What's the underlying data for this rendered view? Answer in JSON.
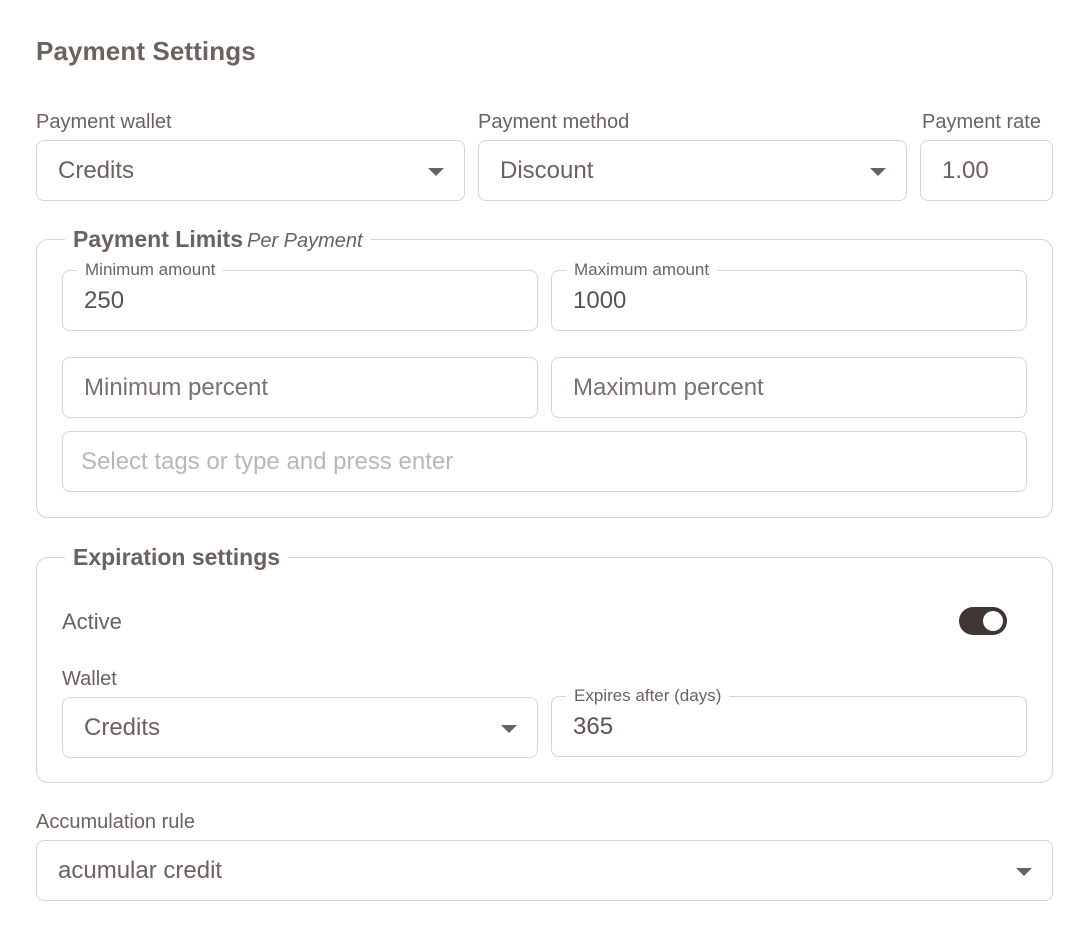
{
  "page": {
    "title": "Payment Settings"
  },
  "payment": {
    "wallet_label": "Payment wallet",
    "wallet_value": "Credits",
    "method_label": "Payment method",
    "method_value": "Discount",
    "rate_label": "Payment rate",
    "rate_value": "1.00"
  },
  "limits": {
    "legend": "Payment Limits",
    "legend_sub": "Per Payment",
    "min_amount_label": "Minimum amount",
    "min_amount_value": "250",
    "max_amount_label": "Maximum amount",
    "max_amount_value": "1000",
    "min_percent_placeholder": "Minimum percent",
    "max_percent_placeholder": "Maximum percent",
    "tags_placeholder": "Select tags or type and press enter"
  },
  "expiration": {
    "legend": "Expiration settings",
    "active_label": "Active",
    "active_on": true,
    "wallet_label": "Wallet",
    "wallet_value": "Credits",
    "expires_label": "Expires after (days)",
    "expires_value": "365"
  },
  "accumulation": {
    "label": "Accumulation rule",
    "value": "acumular credit"
  },
  "colors": {
    "text": "#6b625d",
    "border": "#d9d4d1",
    "toggle_on": "#3f3633"
  },
  "icons": {
    "dropdown": "caret-down-icon"
  }
}
